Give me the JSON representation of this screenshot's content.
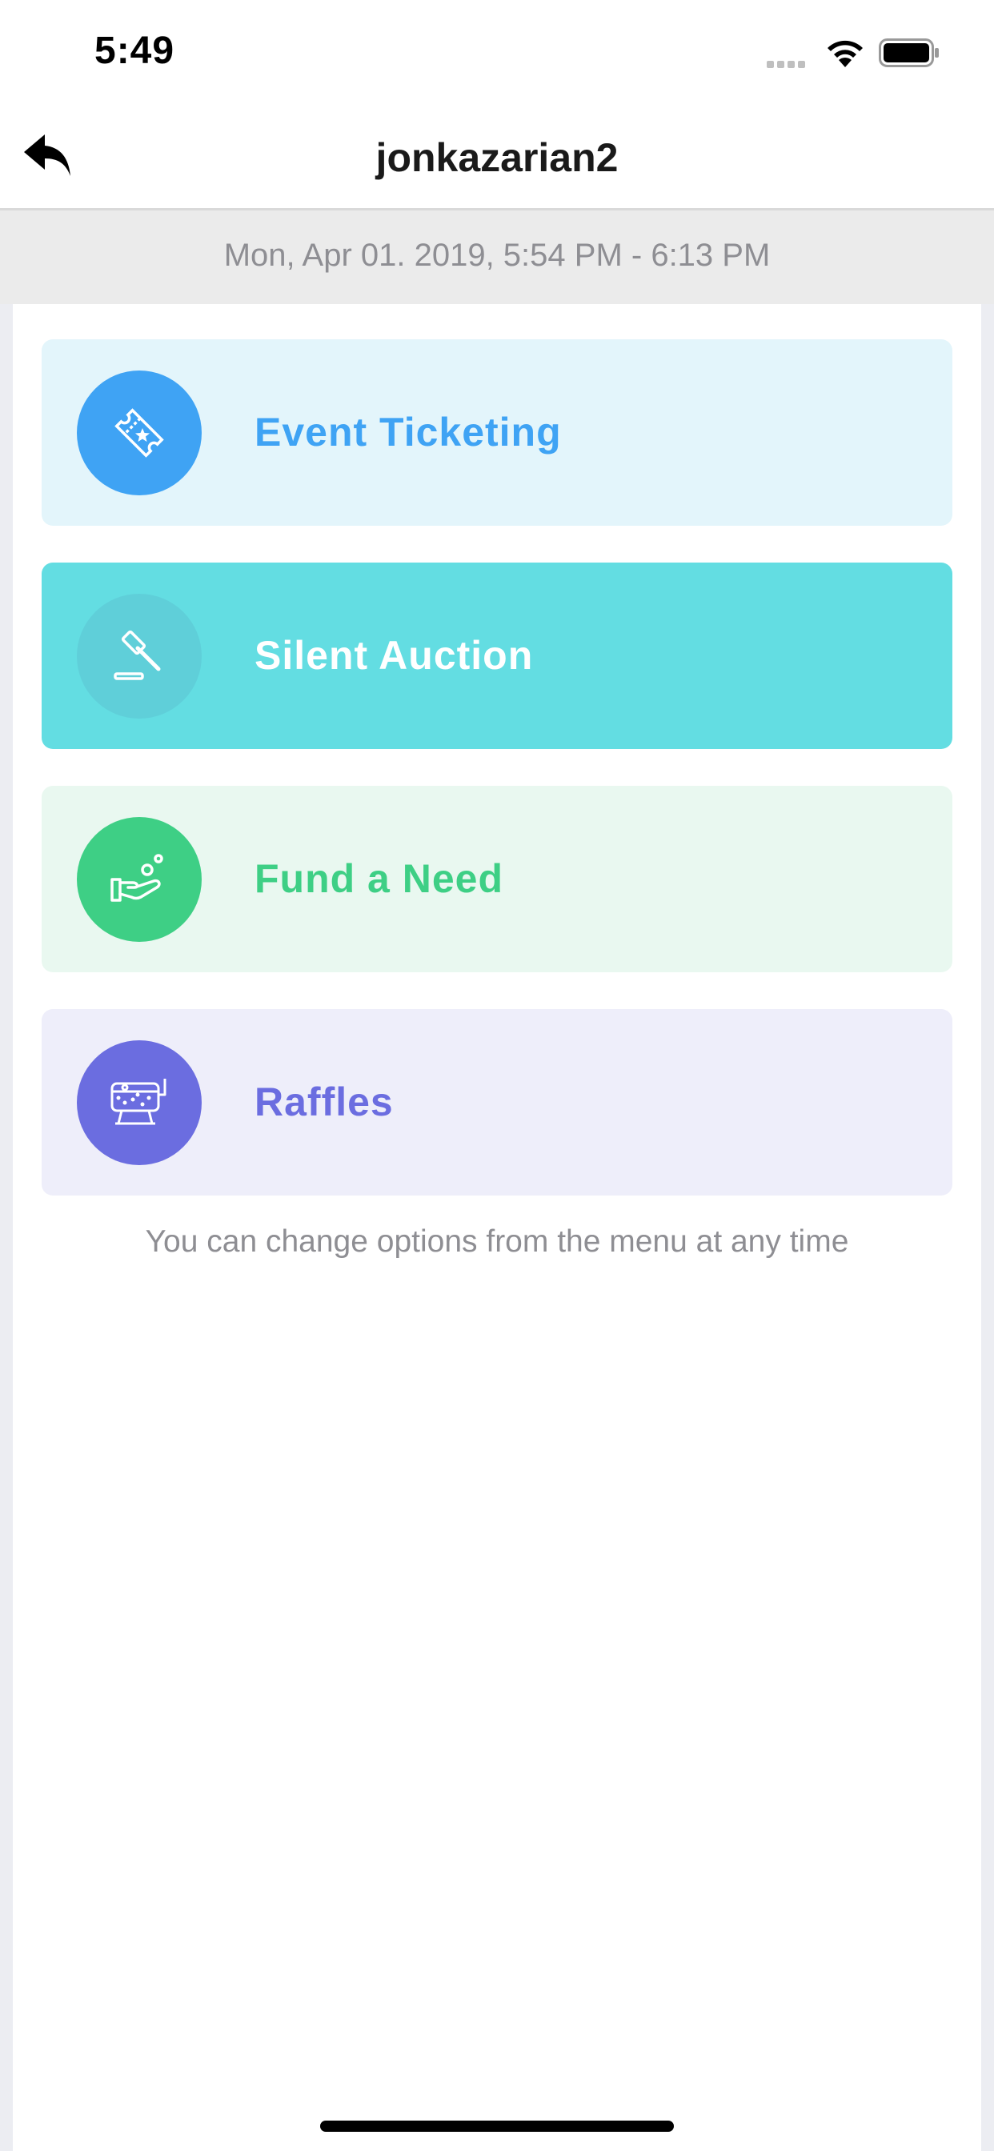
{
  "status_bar": {
    "time": "5:49"
  },
  "header": {
    "title": "jonkazarian2"
  },
  "event": {
    "date_range": "Mon, Apr 01. 2019, 5:54 PM - 6:13 PM"
  },
  "options": [
    {
      "label": "Event Ticketing",
      "icon": "ticket-icon",
      "bg": "#e3f5fb",
      "circle": "#3fa3f4",
      "text_color": "#3fa3f4"
    },
    {
      "label": "Silent Auction",
      "icon": "gavel-icon",
      "bg": "#63dde2",
      "circle": "#5fcfd9",
      "text_color": "#ffffff"
    },
    {
      "label": "Fund a Need",
      "icon": "donation-hand-icon",
      "bg": "#e9f8f0",
      "circle": "#3ecf85",
      "text_color": "#3ecf85"
    },
    {
      "label": "Raffles",
      "icon": "raffle-drum-icon",
      "bg": "#eeeefa",
      "circle": "#6b6de0",
      "text_color": "#6b6de0"
    }
  ],
  "footer_note": "You can change options from the menu at any time"
}
